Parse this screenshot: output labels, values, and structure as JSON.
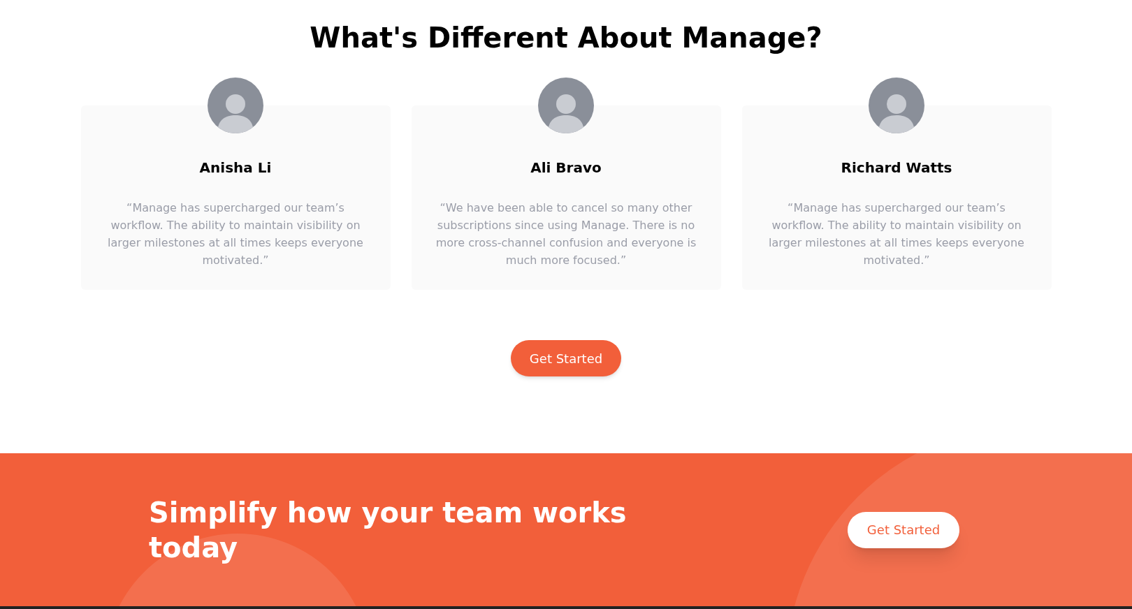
{
  "heading": "What's Different About Manage?",
  "testimonials": [
    {
      "name": "Anisha Li",
      "quote": "“Manage has supercharged our team’s workflow. The ability to maintain visibility on larger milestones at all times keeps everyone motivated.”"
    },
    {
      "name": "Ali Bravo",
      "quote": "“We have been able to cancel so many other subscriptions since using Manage. There is no more cross-channel confusion and everyone is much more focused.”"
    },
    {
      "name": "Richard Watts",
      "quote": "“Manage has supercharged our team’s workflow. The ability to maintain visibility on larger milestones at all times keeps everyone motivated.”"
    }
  ],
  "cta_button": "Get Started",
  "banner": {
    "headline": "Simplify how your team works today",
    "button": "Get Started"
  }
}
